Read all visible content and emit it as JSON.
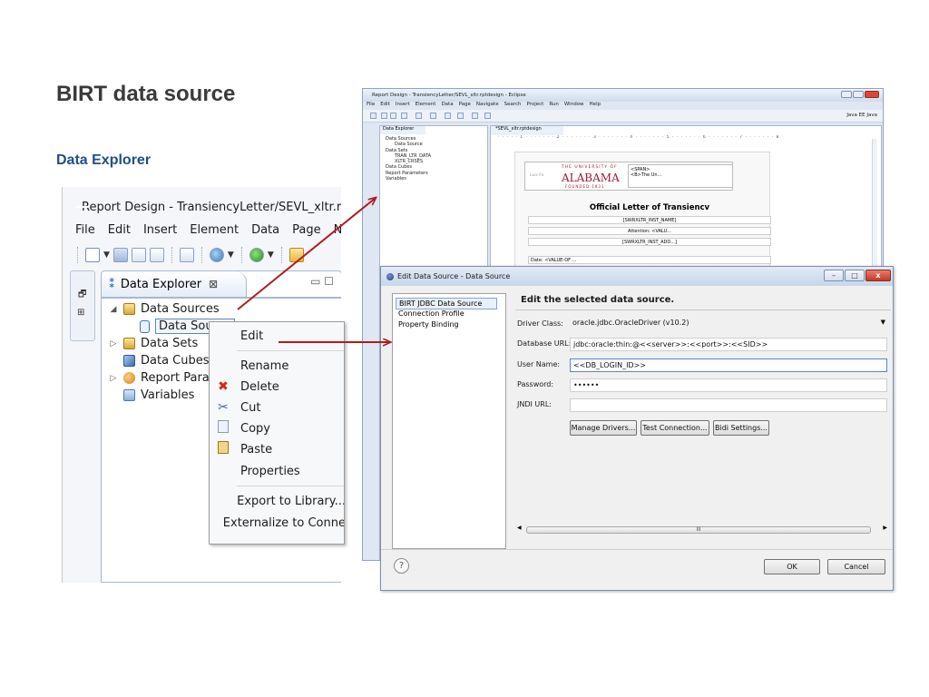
{
  "slide": {
    "title": "BIRT data source",
    "subtitle": "Data Explorer"
  },
  "left_window": {
    "title": "Report Design - TransiencyLetter/SEVL_xltr.rptdesig",
    "menu": [
      "File",
      "Edit",
      "Insert",
      "Element",
      "Data",
      "Page",
      "Navigat"
    ],
    "view_tab": {
      "label": "Data Explorer",
      "close_glyph": "⊠",
      "controls": "▭ ☐"
    },
    "tree": {
      "data_sources": "Data Sources",
      "data_source": "Data Source",
      "data_sets": "Data Sets",
      "data_cubes": "Data Cubes",
      "report_params": "Report Param",
      "variables": "Variables"
    }
  },
  "context_menu": {
    "items": [
      {
        "label": "Edit",
        "icon": ""
      },
      {
        "label": "Rename",
        "icon": ""
      },
      {
        "label": "Delete",
        "icon": "delete-icon"
      },
      {
        "label": "Cut",
        "icon": "cut-icon"
      },
      {
        "label": "Copy",
        "icon": "copy-icon"
      },
      {
        "label": "Paste",
        "icon": "paste-icon"
      },
      {
        "label": "Properties",
        "icon": ""
      },
      {
        "label": "Export to Library...",
        "icon": ""
      },
      {
        "label": "Externalize to Conne",
        "icon": ""
      }
    ]
  },
  "right_window": {
    "title": "Report Design - TransiencyLetter/SEVL_xltr.rptdesign - Eclipse",
    "menu": [
      "File",
      "Edit",
      "Insert",
      "Element",
      "Data",
      "Page",
      "Navigate",
      "Search",
      "Project",
      "Run",
      "Window",
      "Help"
    ],
    "perspectives": "Java EE   Java",
    "explorer_tab": "Data Explorer",
    "tree": [
      "Data Sources",
      "Data Source",
      "Data Sets",
      "TRAN_LTR_DATA",
      "XLTR_CRSES",
      "Data Cubes",
      "Report Parameters",
      "Variables"
    ],
    "editor_tab": "*SEVL_xltr.rptdesign",
    "ruler": "· · · · · 1 · · · · · · · 2 · · · · · · · 3 · · · · · · · 4 · · · · · · · 5 · · · · · · · 6 · · · · · · · 7 · · · · · · · 8",
    "logo_small": "Luis Fe",
    "logo_uni": "THE UNIVERSITY OF",
    "logo_name": "ALABAMA",
    "logo_founded": "FOUNDED 1831",
    "span_text": "<SPAN>\n<B>The Un...",
    "heading": "Official Letter of Transiencv",
    "field1": "[SWRXLTR_INST_NAME]",
    "field2": "Attention: <VALU...",
    "field3": "[SWRXLTR_INST_ADD...]",
    "date": "Date: <VALUE-OF ..."
  },
  "dialog": {
    "title": "Edit Data Source - Data Source",
    "win_buttons": [
      "–",
      "□",
      "x"
    ],
    "nav": [
      "BIRT JDBC Data Source",
      "Connection Profile",
      "Property Binding"
    ],
    "heading": "Edit the selected data source.",
    "fields": {
      "driver_class_label": "Driver Class:",
      "driver_class_value": "oracle.jdbc.OracleDriver (v10.2)",
      "db_url_label": "Database URL:",
      "db_url_value": "jdbc:oracle:thin:@<<server>>:<<port>>:<<SID>>",
      "user_label": "User Name:",
      "user_value": "<<DB_LOGIN_ID>>",
      "password_label": "Password:",
      "password_value": "••••••",
      "jndi_label": "JNDI URL:",
      "jndi_value": ""
    },
    "buttons": {
      "manage_drivers": "Manage Drivers...",
      "test_connection": "Test Connection...",
      "bidi_settings": "Bidi Settings...",
      "ok": "OK",
      "cancel": "Cancel"
    },
    "scroll_label": "III",
    "help_glyph": "?"
  },
  "colors": {
    "title": "#3a3a3a",
    "subtitle": "#1f4e8c",
    "arrow": "#b01c1c",
    "delete_icon": "#d9261c"
  }
}
